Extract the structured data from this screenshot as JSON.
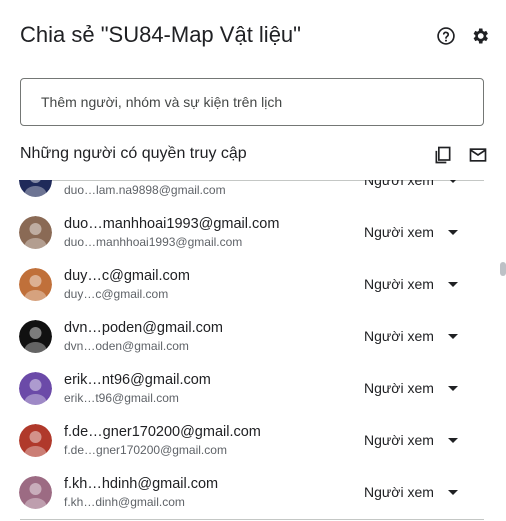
{
  "dialog": {
    "title": "Chia sẻ \"SU84-Map Vật liệu\"",
    "help_icon": "help-circle-icon",
    "settings_icon": "gear-icon"
  },
  "add_people": {
    "placeholder": "Thêm người, nhóm và sự kiện trên lịch"
  },
  "access": {
    "title": "Những người có quyền truy cập",
    "copy_icon": "copy-icon",
    "email_icon": "mail-icon",
    "people": [
      {
        "name": "",
        "email": "duo…lam.na9898@gmail.com",
        "role": "Người xem",
        "avatar_color": "#1f2a5a"
      },
      {
        "name": "duo…manhhoai1993@gmail.com",
        "email": "duo…manhhoai1993@gmail.com",
        "role": "Người xem",
        "avatar_color": "#8a6a55"
      },
      {
        "name": "duy…c@gmail.com",
        "email": "duy…c@gmail.com",
        "role": "Người xem",
        "avatar_color": "#c0703a"
      },
      {
        "name": "dvn…poden@gmail.com",
        "email": "dvn…oden@gmail.com",
        "role": "Người xem",
        "avatar_color": "#111111"
      },
      {
        "name": "erik…nt96@gmail.com",
        "email": "erik…t96@gmail.com",
        "role": "Người xem",
        "avatar_color": "#6b4aa8"
      },
      {
        "name": "f.de…gner170200@gmail.com",
        "email": "f.de…gner170200@gmail.com",
        "role": "Người xem",
        "avatar_color": "#b0392b"
      },
      {
        "name": "f.kh…hdinh@gmail.com",
        "email": "f.kh…dinh@gmail.com",
        "role": "Người xem",
        "avatar_color": "#9c6b83"
      }
    ]
  }
}
